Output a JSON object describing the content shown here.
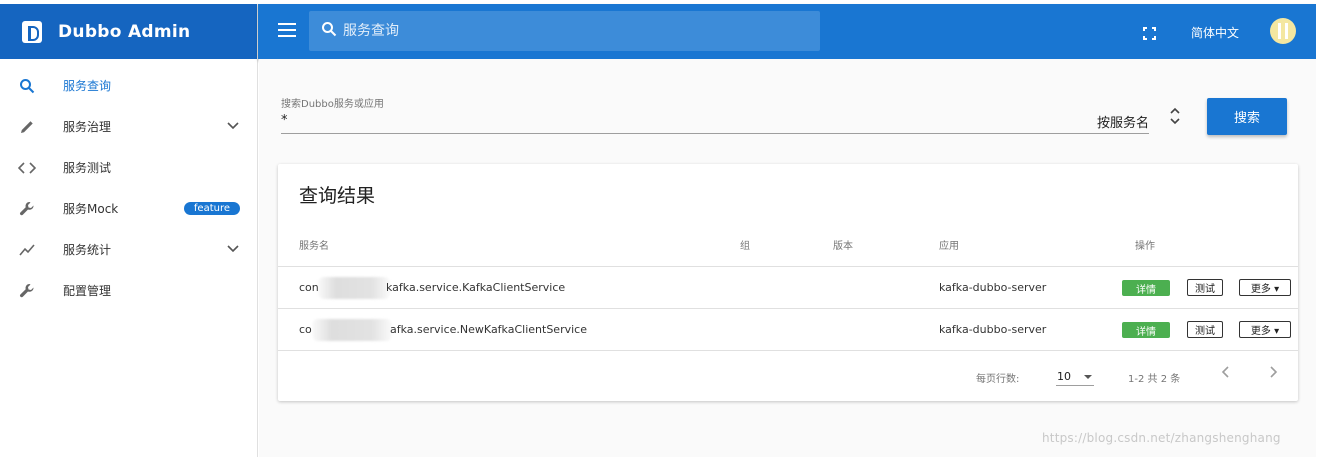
{
  "app": {
    "title": "Dubbo Admin"
  },
  "sidebar": {
    "items": [
      {
        "label": "服务查询",
        "icon": "search-icon"
      },
      {
        "label": "服务治理",
        "icon": "pencil-icon"
      },
      {
        "label": "服务测试",
        "icon": "code-icon"
      },
      {
        "label": "服务Mock",
        "icon": "wrench-icon",
        "badge": "feature"
      },
      {
        "label": "服务统计",
        "icon": "chart-line-icon"
      },
      {
        "label": "配置管理",
        "icon": "wrench-icon"
      }
    ]
  },
  "header": {
    "search_placeholder": "服务查询",
    "language": "简体中文"
  },
  "search_form": {
    "label": "搜索Dubbo服务或应用",
    "value": "*",
    "type_select": "按服务名",
    "submit_label": "搜索"
  },
  "results": {
    "title": "查询结果",
    "columns": [
      "服务名",
      "组",
      "版本",
      "应用",
      "操作"
    ],
    "rows": [
      {
        "service_prefix": "con",
        "service_suffix": "kafka.service.KafkaClientService",
        "group": "",
        "version": "",
        "app": "kafka-dubbo-server"
      },
      {
        "service_prefix": "co",
        "service_suffix": "afka.service.NewKafkaClientService",
        "group": "",
        "version": "",
        "app": "kafka-dubbo-server"
      }
    ],
    "actions": {
      "detail": "详情",
      "test": "测试",
      "more": "更多 ▾"
    },
    "footer": {
      "rows_per_page_label": "每页行数:",
      "rows_per_page": "10",
      "page_info": "1-2 共 2 条"
    }
  },
  "watermark": "https://blog.csdn.net/zhangshenghang",
  "colors": {
    "primary": "#1976d2",
    "brand_dark": "#1565c0",
    "detail_green": "#4caf50"
  }
}
